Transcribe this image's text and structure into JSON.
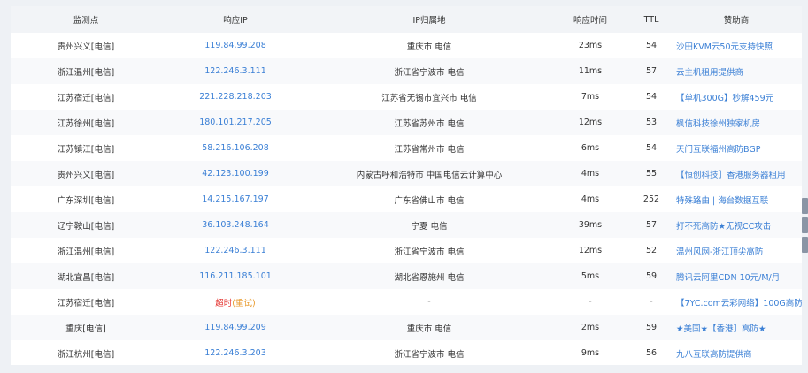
{
  "columns": [
    "监测点",
    "响应IP",
    "IP归属地",
    "响应时间",
    "TTL",
    "赞助商"
  ],
  "rows": [
    {
      "node": "贵州兴义[电信]",
      "ip": "119.84.99.208",
      "location": "重庆市 电信",
      "time": "23ms",
      "ttl": "54",
      "sponsor": "沙田KVM云50元支持快照"
    },
    {
      "node": "浙江温州[电信]",
      "ip": "122.246.3.111",
      "location": "浙江省宁波市 电信",
      "time": "11ms",
      "ttl": "57",
      "sponsor": "云主机租用提供商"
    },
    {
      "node": "江苏宿迁[电信]",
      "ip": "221.228.218.203",
      "location": "江苏省无锡市宜兴市 电信",
      "time": "7ms",
      "ttl": "54",
      "sponsor": "【单机300G】秒解459元"
    },
    {
      "node": "江苏徐州[电信]",
      "ip": "180.101.217.205",
      "location": "江苏省苏州市 电信",
      "time": "12ms",
      "ttl": "53",
      "sponsor": "枫信科技徐州独家机房"
    },
    {
      "node": "江苏镇江[电信]",
      "ip": "58.216.106.208",
      "location": "江苏省常州市 电信",
      "time": "6ms",
      "ttl": "54",
      "sponsor": "天门互联福州高防BGP"
    },
    {
      "node": "贵州兴义[电信]",
      "ip": "42.123.100.199",
      "location": "内蒙古呼和浩特市 中国电信云计算中心",
      "time": "4ms",
      "ttl": "55",
      "sponsor": "【恒创科技】香港服务器租用"
    },
    {
      "node": "广东深圳[电信]",
      "ip": "14.215.167.197",
      "location": "广东省佛山市 电信",
      "time": "4ms",
      "ttl": "252",
      "sponsor": "特殊路由 | 海台数据互联"
    },
    {
      "node": "辽宁鞍山[电信]",
      "ip": "36.103.248.164",
      "location": "宁夏 电信",
      "time": "39ms",
      "ttl": "57",
      "sponsor": "打不死高防★无视CC攻击"
    },
    {
      "node": "浙江温州[电信]",
      "ip": "122.246.3.111",
      "location": "浙江省宁波市 电信",
      "time": "12ms",
      "ttl": "52",
      "sponsor": "温州风网-浙江顶尖高防"
    },
    {
      "node": "湖北宜昌[电信]",
      "ip": "116.211.185.101",
      "location": "湖北省恩施州 电信",
      "time": "5ms",
      "ttl": "59",
      "sponsor": "腾讯云阿里CDN 10元/M/月"
    },
    {
      "node": "江苏宿迁[电信]",
      "ip": "",
      "timeout": "超时",
      "retry": "(重试)",
      "location": "-",
      "time": "-",
      "ttl": "-",
      "sponsor": "【7YC.com云彩网络】100G高防"
    },
    {
      "node": "重庆[电信]",
      "ip": "119.84.99.209",
      "location": "重庆市 电信",
      "time": "2ms",
      "ttl": "59",
      "sponsor": "★美国★【香港】高防★"
    },
    {
      "node": "浙江杭州[电信]",
      "ip": "122.246.3.203",
      "location": "浙江省宁波市 电信",
      "time": "9ms",
      "ttl": "56",
      "sponsor": "九八互联高防提供商"
    }
  ]
}
